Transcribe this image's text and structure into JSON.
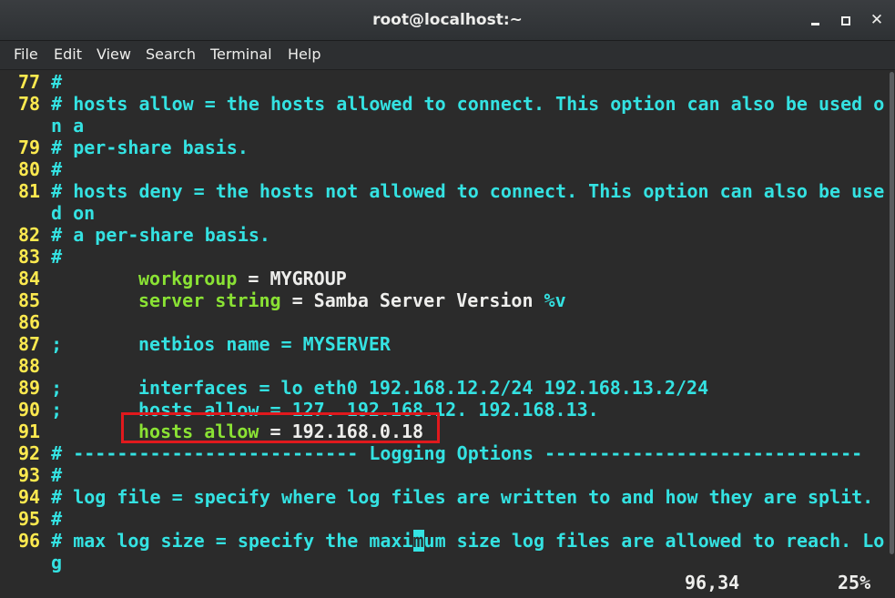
{
  "window": {
    "title": "root@localhost:~",
    "minimize_icon": "minimize-icon",
    "maximize_icon": "maximize-icon",
    "close_icon": "close-icon",
    "close_glyph": "✕"
  },
  "menu": {
    "file": "File",
    "edit": "Edit",
    "view": "View",
    "search": "Search",
    "terminal": "Terminal",
    "help": "Help"
  },
  "lines": [
    {
      "num": "77",
      "text": "#"
    },
    {
      "num": "78",
      "text": "# hosts allow = the hosts allowed to connect. This option can also be used o",
      "wrap": "n a"
    },
    {
      "num": "79",
      "text": "# per-share basis."
    },
    {
      "num": "80",
      "text": "#"
    },
    {
      "num": "81",
      "text": "# hosts deny = the hosts not allowed to connect. This option can also be use",
      "wrap": "d on"
    },
    {
      "num": "82",
      "text": "# a per-share basis."
    },
    {
      "num": "83",
      "text": "#"
    },
    {
      "num": "84",
      "key": "workgroup",
      "val": "= MYGROUP"
    },
    {
      "num": "85",
      "key": "server string",
      "val": "= Samba Server Version ",
      "extra": "%v"
    },
    {
      "num": "86",
      "text": ""
    },
    {
      "num": "87",
      "prefix": ";",
      "text": "netbios name = MYSERVER"
    },
    {
      "num": "88",
      "text": ""
    },
    {
      "num": "89",
      "prefix": ";",
      "text": "interfaces = lo eth0 192.168.12.2/24 192.168.13.2/24"
    },
    {
      "num": "90",
      "prefix": ";",
      "text": "hosts allow = 127. 192.168.12. 192.168.13."
    },
    {
      "num": "91",
      "key": "hosts allow",
      "val": "= 192.168.0.18"
    },
    {
      "num": "92",
      "text": "# -------------------------- Logging Options -----------------------------"
    },
    {
      "num": "93",
      "text": "#"
    },
    {
      "num": "94",
      "text": "# log file = specify where log files are written to and how they are split."
    },
    {
      "num": "95",
      "text": "#"
    },
    {
      "num": "96",
      "text_a": "# max log size = specify the maxi",
      "cursor_char": "m",
      "text_b": "um size log files are allowed to reach. Lo",
      "wrap": "g"
    }
  ],
  "status": {
    "position": "96,34",
    "percent": "25%"
  },
  "colors": {
    "line_number": "#fce94f",
    "comment": "#34e2e2",
    "keyword": "#8ae234",
    "highlight_border": "#e0191d"
  }
}
